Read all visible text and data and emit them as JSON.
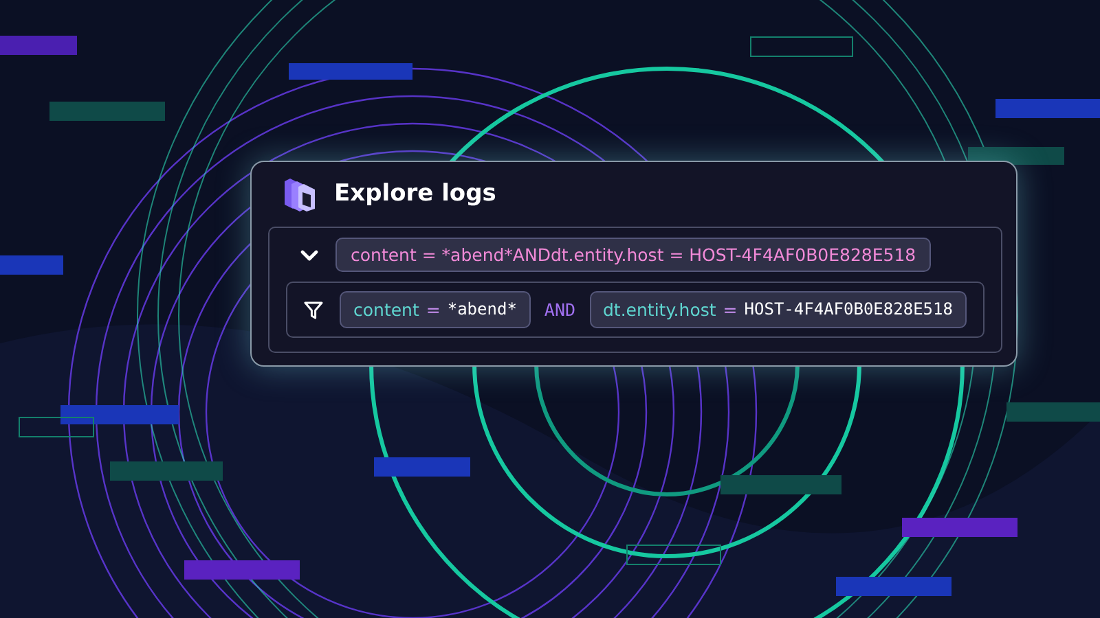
{
  "card": {
    "title": "Explore logs",
    "query": {
      "expanded": true,
      "text": "content = *abend*ANDdt.entity.host = HOST-4F4AF0B0E828E518"
    },
    "filters": [
      {
        "key": "content",
        "operator": "=",
        "value": "*abend*"
      },
      {
        "key": "dt.entity.host",
        "operator": "=",
        "value": "HOST-4F4AF0B0E828E518"
      }
    ],
    "joiner": "AND"
  }
}
